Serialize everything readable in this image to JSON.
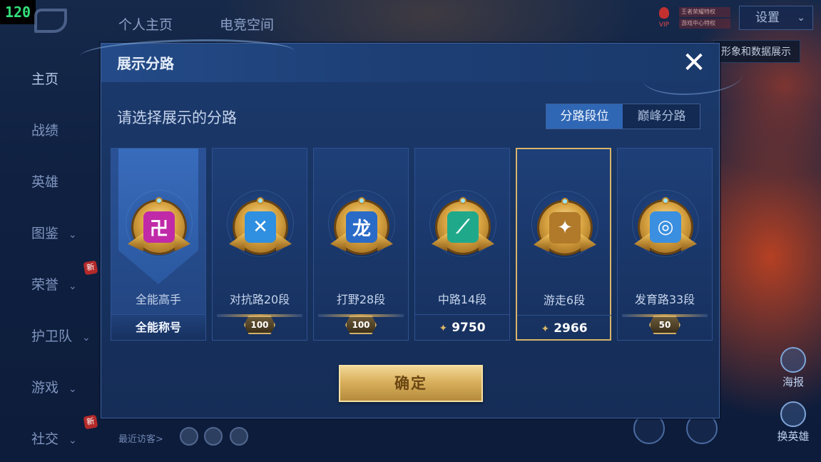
{
  "fps": "120",
  "nav": {
    "items": [
      {
        "label": "主页",
        "chevron": false,
        "badge": ""
      },
      {
        "label": "战绩",
        "chevron": false,
        "badge": ""
      },
      {
        "label": "英雄",
        "chevron": false,
        "badge": ""
      },
      {
        "label": "图鉴",
        "chevron": true,
        "badge": ""
      },
      {
        "label": "荣誉",
        "chevron": true,
        "badge": "新"
      },
      {
        "label": "护卫队",
        "chevron": true,
        "badge": ""
      },
      {
        "label": "游戏",
        "chevron": true,
        "badge": ""
      },
      {
        "label": "社交",
        "chevron": true,
        "badge": "新"
      }
    ]
  },
  "top_tabs": [
    "个人主页",
    "电竞空间"
  ],
  "settings": {
    "label": "设置"
  },
  "vip": {
    "label": "VIP",
    "line1": "王者荣耀特权",
    "line2": "游戏中心特权"
  },
  "side_tooltip": "形象和数据展示",
  "right_buttons": [
    {
      "label": "海报",
      "icon": "poster-icon"
    },
    {
      "label": "换英雄",
      "icon": "swap-hero-icon"
    }
  ],
  "visitors": {
    "label": "最近访客>"
  },
  "dialog": {
    "title": "展示分路",
    "close_icon": "close-icon",
    "prompt": "请选择展示的分路",
    "toggle": {
      "options": [
        "分路段位",
        "巅峰分路"
      ],
      "selected": 0
    },
    "lanes": [
      {
        "name": "全能高手",
        "sub": "全能称号",
        "kind": "title",
        "emblem_color": "#c02aa8",
        "emblem_glyph": "卍",
        "stars": "",
        "points": "",
        "featured": true,
        "selected": false
      },
      {
        "name": "对抗路20段",
        "sub": "",
        "kind": "stars",
        "emblem_color": "#2f8fe0",
        "emblem_glyph": "✕",
        "stars": "100",
        "points": "",
        "featured": false,
        "selected": false
      },
      {
        "name": "打野28段",
        "sub": "",
        "kind": "stars",
        "emblem_color": "#2a6bc8",
        "emblem_glyph": "龙",
        "stars": "100",
        "points": "",
        "featured": false,
        "selected": false
      },
      {
        "name": "中路14段",
        "sub": "",
        "kind": "points",
        "emblem_color": "#1fa98a",
        "emblem_glyph": "⟋",
        "stars": "",
        "points": "9750",
        "featured": false,
        "selected": false
      },
      {
        "name": "游走6段",
        "sub": "",
        "kind": "points",
        "emblem_color": "#b07a2a",
        "emblem_glyph": "✦",
        "stars": "",
        "points": "2966",
        "featured": false,
        "selected": true
      },
      {
        "name": "发育路33段",
        "sub": "",
        "kind": "stars",
        "emblem_color": "#3a8fe0",
        "emblem_glyph": "◎",
        "stars": "50",
        "points": "",
        "featured": false,
        "selected": false
      }
    ],
    "confirm": "确定"
  }
}
